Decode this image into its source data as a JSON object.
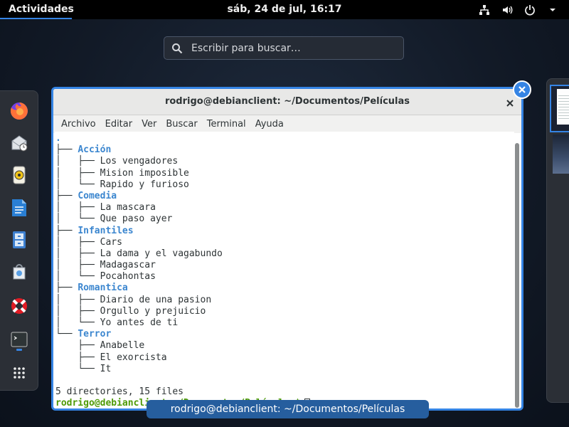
{
  "topbar": {
    "activities_label": "Actividades",
    "clock": "sáb, 24 de jul, 16:17",
    "tray": [
      "network-icon",
      "volume-icon",
      "power-icon",
      "dropdown-icon"
    ]
  },
  "search": {
    "placeholder": "Escribir para buscar…"
  },
  "dash": {
    "apps": [
      "firefox-icon",
      "evolution-mail-icon",
      "rhythmbox-icon",
      "writer-document-icon",
      "files-cabinet-icon",
      "software-center-icon",
      "help-lifebuoy-icon",
      "terminal-icon",
      "show-applications-icon"
    ]
  },
  "window": {
    "title": "rodrigo@debianclient: ~/Documentos/Películas",
    "menu": [
      "Archivo",
      "Editar",
      "Ver",
      "Buscar",
      "Terminal",
      "Ayuda"
    ],
    "label": "rodrigo@debianclient: ~/Documentos/Películas"
  },
  "terminal": {
    "root": ".",
    "dirs": [
      {
        "name": "Acción",
        "files": [
          "Los vengadores",
          "Mision imposible",
          "Rapido y furioso"
        ]
      },
      {
        "name": "Comedia",
        "files": [
          "La mascara",
          "Que paso ayer"
        ]
      },
      {
        "name": "Infantiles",
        "files": [
          "Cars",
          "La dama y el vagabundo",
          "Madagascar",
          "Pocahontas"
        ]
      },
      {
        "name": "Romantica",
        "files": [
          "Diario de una pasion",
          "Orgullo y prejuicio",
          "Yo antes de ti"
        ]
      },
      {
        "name": "Terror",
        "files": [
          "Anabelle",
          "El exorcista",
          "It"
        ]
      }
    ],
    "summary": "5 directories, 15 files",
    "prompt": "rodrigo@debianclient:~/Documentos/Películas$"
  },
  "colors": {
    "accent": "#3584e4",
    "dir": "#3b86cf",
    "prompt": "#4e9a06"
  }
}
